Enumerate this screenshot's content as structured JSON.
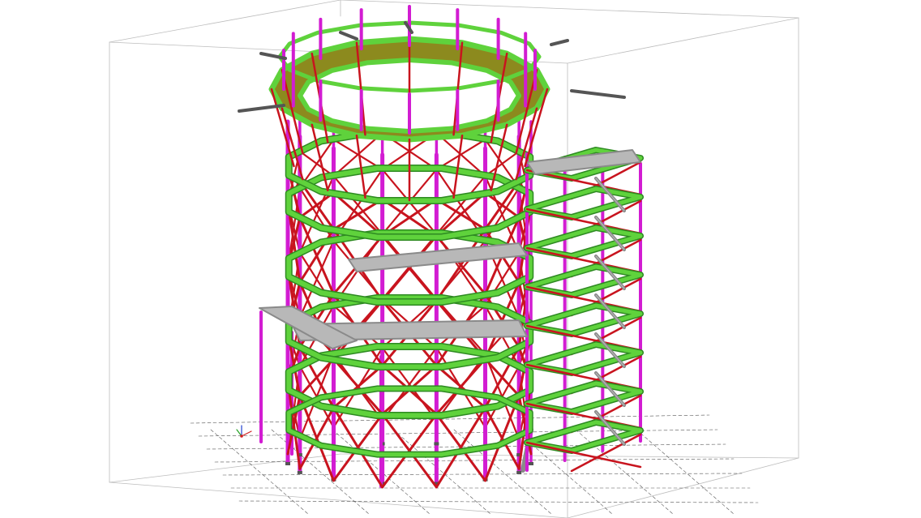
{
  "viewport": {
    "background": "#ffffff"
  },
  "colors": {
    "columns": "#d21cd2",
    "bracing": "#c8141e",
    "beams": "#5fd23c",
    "beam_edge": "#2e8a22",
    "decking": "#8c8a1e",
    "gratings": "#8a8a8a",
    "bounding_box": "#bdbdbd",
    "axes_grid": "#555555",
    "cantilevers": "#555555"
  },
  "icons": {
    "coordinate_axes": "axes-icon"
  }
}
